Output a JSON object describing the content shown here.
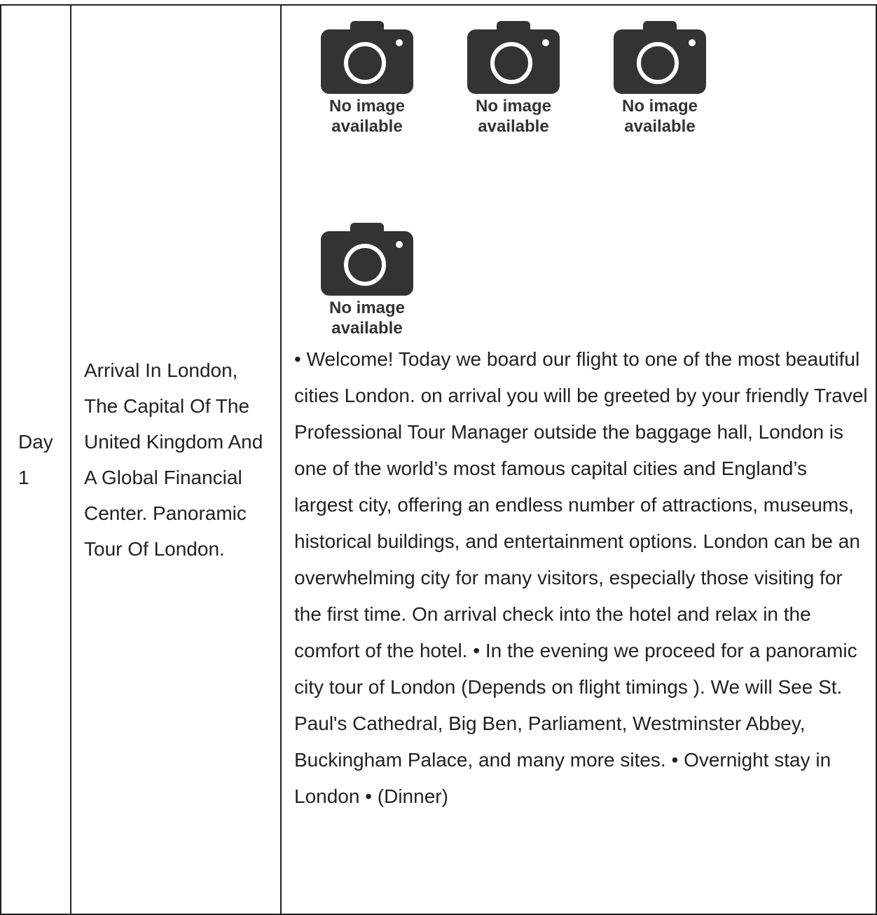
{
  "itinerary": {
    "day": "Day 1",
    "title": "Arrival In London, The Capital Of The United Kingdom And A Global Financial Center. Panoramic Tour Of London.",
    "photos": [
      {
        "caption": "No image\navailable",
        "icon": "camera-icon"
      },
      {
        "caption": "No image\navailable",
        "icon": "camera-icon"
      },
      {
        "caption": "No image\navailable",
        "icon": "camera-icon"
      },
      {
        "caption": "No image\navailable",
        "icon": "camera-icon"
      }
    ],
    "description": "• Welcome! Today we board our flight to one of the most beautiful cities London. on arrival you will be greeted by your friendly Travel Professional Tour Manager outside the baggage hall, London is one of the world’s most famous capital cities and England’s largest city, offering an endless number of attractions, museums, historical buildings, and entertainment options. London can be an overwhelming city for many visitors, especially those visiting for the first time. On arrival check into the hotel and relax in the comfort of the hotel. • In the evening we proceed for a panoramic city tour of London (Depends on flight timings ). We will See St. Paul's Cathedral, Big Ben, Parliament, Westminster Abbey, Buckingham Palace, and many more sites. • Overnight stay in London • (Dinner)"
  },
  "colors": {
    "border": "#222222",
    "placeholder": "#333333",
    "text": "#222222"
  }
}
